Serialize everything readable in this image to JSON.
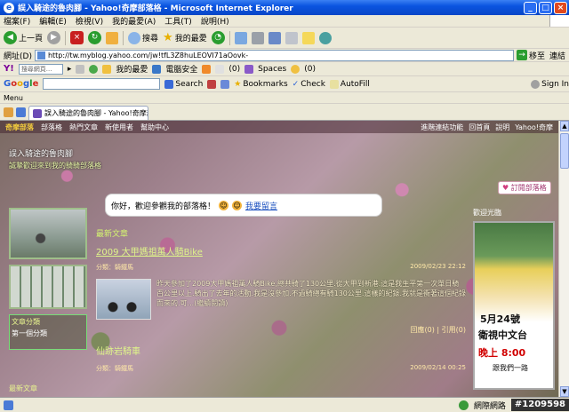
{
  "window": {
    "title": "誤入騎途的魯肉腳 - Yahoo!奇摩部落格 - Microsoft Internet Explorer",
    "buttons": [
      "_",
      "□",
      "×"
    ]
  },
  "menubar": {
    "items": [
      "檔案(F)",
      "編輯(E)",
      "檢視(V)",
      "我的最愛(A)",
      "工具(T)",
      "說明(H)"
    ]
  },
  "toolbar": {
    "back_label": "上一頁",
    "search_label": "搜尋",
    "favorites_label": "我的最愛"
  },
  "address": {
    "label": "網址(D)",
    "url": "http://tw.myblog.yahoo.com/jw!tfL3Z8huLEOVI71aOovk-",
    "go_label": "移至",
    "links_label": "連結"
  },
  "yahoo_toolbar": {
    "logo": "Y!",
    "search_placeholder": "搜尋網頁...",
    "favorites": "我的最愛",
    "security": "電腦安全",
    "mail_count": "(0)",
    "spaces": "Spaces",
    "msgr_count": "(0)"
  },
  "google_toolbar": {
    "logo": [
      "G",
      "o",
      "o",
      "g",
      "l",
      "e"
    ],
    "search_label": "Search",
    "bookmarks_label": "Bookmarks",
    "check_label": "Check",
    "autofill_label": "AutoFill",
    "signin_label": "Sign In"
  },
  "links_toolbar": {
    "label": "Menu"
  },
  "tab": {
    "label": "誤入騎途的魯肉腳 - Yahoo!奇摩部..."
  },
  "blog": {
    "topnav": {
      "logo": "奇摩部落",
      "items": [
        "部落格",
        "熱門文章",
        "新使用者",
        "幫助中心"
      ],
      "right_items": [
        "進階連結功能",
        "回首頁",
        "說明",
        "Yahoo!奇摩"
      ]
    },
    "header_title": "誤入騎途的魯肉腳",
    "header_subtitle": "誠摯歡迎來到我的騎騎部落格",
    "subscribe_label": "訂閱部落格",
    "greeting": "你好，歡迎參觀我的部落格！",
    "greeting_link": "我要留言",
    "left_title": "文章分類",
    "left_sub": "第一個分類",
    "bottom_left": "最新文章",
    "main": {
      "section_title": "最新文章",
      "post1": {
        "title": "2009 大甲媽祖萬人騎Bike",
        "category": "分類：騎鐵馬",
        "date": "2009/02/23 22:12",
        "body": "昨天參加了2009大甲媽祖萬人騎Bike,總共騎了130公里.從大甲到新港.這是我生平第一次單日騎百公里以上.騎出了去年的活動.我是沒參加.不過騎總有騎130公里.這樣的紀錄.我就是衝著這個紀錄而來的.可...(繼續閱讀)",
        "footer": "回應(0) | 引用(0)"
      },
      "post2": {
        "title": "仙跡岩騎車",
        "category": "分類：騎鐵馬",
        "date": "2009/02/14 00:25"
      }
    },
    "right": {
      "title": "歡迎光臨",
      "ad_date": "5月24號",
      "ad_channel": "衛視中文台",
      "ad_time": "晚上 8:00",
      "ad_cta": "跟我們一路"
    }
  },
  "statusbar": {
    "zone": "網際網路",
    "watermark": "#1209598"
  }
}
